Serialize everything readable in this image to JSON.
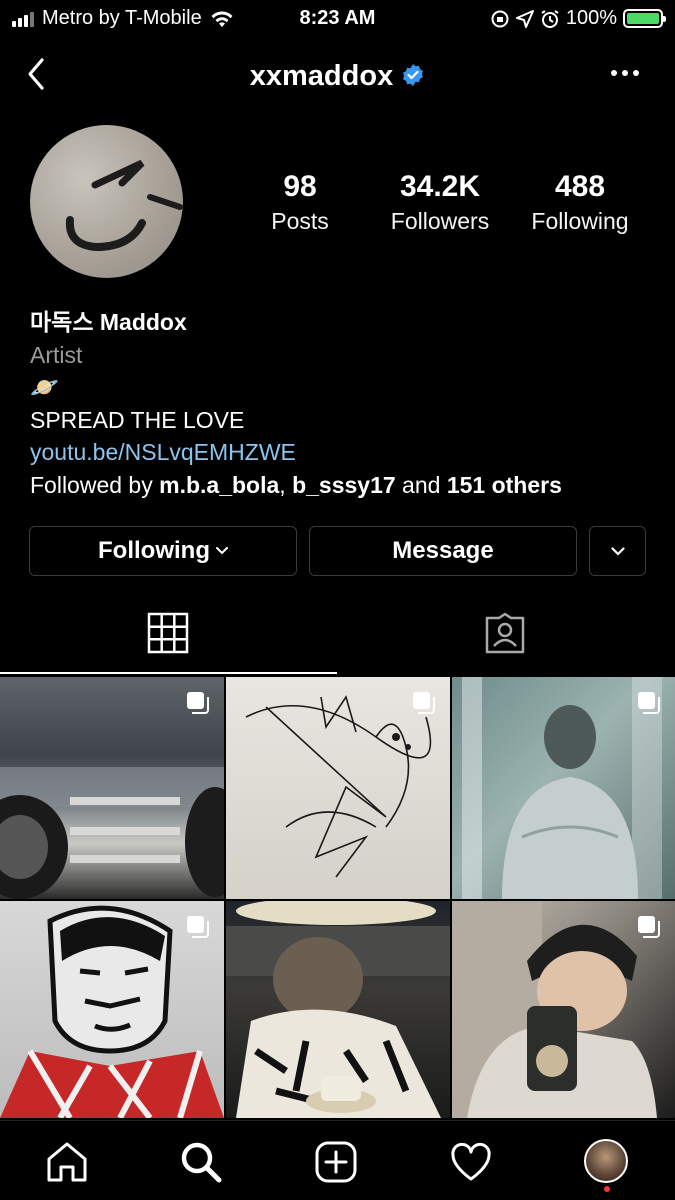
{
  "status_bar": {
    "carrier": "Metro by T-Mobile",
    "time": "8:23 AM",
    "battery": "100%"
  },
  "header": {
    "username": "xxmaddox"
  },
  "stats": [
    {
      "value": "98",
      "label": "Posts"
    },
    {
      "value": "34.2K",
      "label": "Followers"
    },
    {
      "value": "488",
      "label": "Following"
    }
  ],
  "bio": {
    "name": "마독스 Maddox",
    "category": "Artist",
    "emoji": "🪐",
    "text": "SPREAD THE LOVE",
    "link": "youtu.be/NSLvqEMHZWE",
    "followed_prefix": "Followed by ",
    "followed_user1": "m.b.a_bola",
    "followed_sep": ", ",
    "followed_user2": "b_sssy17",
    "followed_and": " and ",
    "followed_others": "151 others"
  },
  "buttons": {
    "following": "Following",
    "message": "Message"
  },
  "colors": {
    "background": "#000000",
    "link": "#8cc4ee",
    "verified": "#3897f0",
    "battery": "#4cd964"
  },
  "icons": {
    "back": "chevron-left-icon",
    "verified": "verified-badge-icon",
    "more": "more-horizontal-icon",
    "grid": "grid-icon",
    "tagged": "tagged-person-icon",
    "multi": "multiple-images-icon",
    "home": "home-icon",
    "search": "search-icon",
    "add": "add-post-icon",
    "activity": "heart-icon"
  }
}
